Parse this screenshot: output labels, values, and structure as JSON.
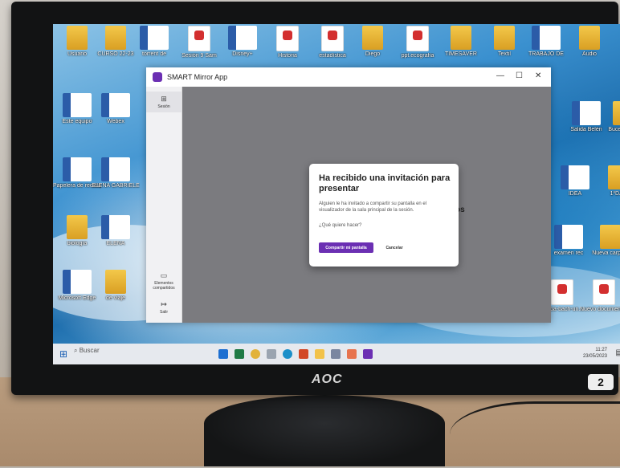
{
  "desktop": {
    "icons": [
      {
        "label": "Usuario",
        "kind": "folder"
      },
      {
        "label": "CURSO 22-23",
        "kind": "folder"
      },
      {
        "label": "torrent de",
        "kind": "word"
      },
      {
        "label": "Sesión 9 Sam",
        "kind": "pdf"
      },
      {
        "label": "Disney+",
        "kind": "word"
      },
      {
        "label": "Historia",
        "kind": "pdf"
      },
      {
        "label": "estadística",
        "kind": "pdf"
      },
      {
        "label": "Diego",
        "kind": "folder"
      },
      {
        "label": "ppt.ecografía",
        "kind": "pdf"
      },
      {
        "label": "TIMESAVER",
        "kind": "folder"
      },
      {
        "label": "Textil",
        "kind": "folder"
      },
      {
        "label": "TRABAJO DE",
        "kind": "word"
      },
      {
        "label": "Audio",
        "kind": "folder"
      },
      {
        "label": "Este equipo",
        "kind": "word"
      },
      {
        "label": "Webex",
        "kind": "word"
      },
      {
        "label": "Salida Belén",
        "kind": "word"
      },
      {
        "label": "Buceador_c",
        "kind": "folder"
      },
      {
        "label": "Papelera de reciclaje",
        "kind": "word"
      },
      {
        "label": "ELENA GABRIELE",
        "kind": "word"
      },
      {
        "label": "IDEA",
        "kind": "word"
      },
      {
        "label": "1ºDAS",
        "kind": "folder"
      },
      {
        "label": "biología",
        "kind": "folder"
      },
      {
        "label": "ELENA",
        "kind": "word"
      },
      {
        "label": "examen rec",
        "kind": "word"
      },
      {
        "label": "Nueva carpeta",
        "kind": "folder"
      },
      {
        "label": "Microsoft Edge",
        "kind": "word"
      },
      {
        "label": "de viaje",
        "kind": "folder"
      },
      {
        "label": "1c2ba-bach-un...",
        "kind": "pdf"
      },
      {
        "label": "Nuevo documento...",
        "kind": "pdf"
      }
    ]
  },
  "taskbar": {
    "search_placeholder": "Buscar",
    "time": "11:27",
    "date": "23/05/2023"
  },
  "app": {
    "title": "SMART Mirror App",
    "minimize_glyph": "—",
    "maximize_glyph": "☐",
    "close_glyph": "✕",
    "sidebar": {
      "session_label": "Sesión",
      "shared_label": "Elementos compartidos",
      "exit_label": "Salir"
    },
    "background_text": "entos"
  },
  "dialog": {
    "title": "Ha recibido una invitación para presentar",
    "body": "Alguien le ha invitado a compartir su pantalla en el visualizador de la sala principal de la sesión.",
    "question": "¿Qué quiere hacer?",
    "primary_label": "Compartir mi pantalla",
    "cancel_label": "Cancelar"
  },
  "monitor": {
    "brand": "AOC",
    "sticker": "2"
  },
  "colors": {
    "accent": "#6b2fb3",
    "word_blue": "#2b5ca8",
    "pdf_red": "#d32f2f",
    "folder_yellow": "#f3c84a"
  }
}
